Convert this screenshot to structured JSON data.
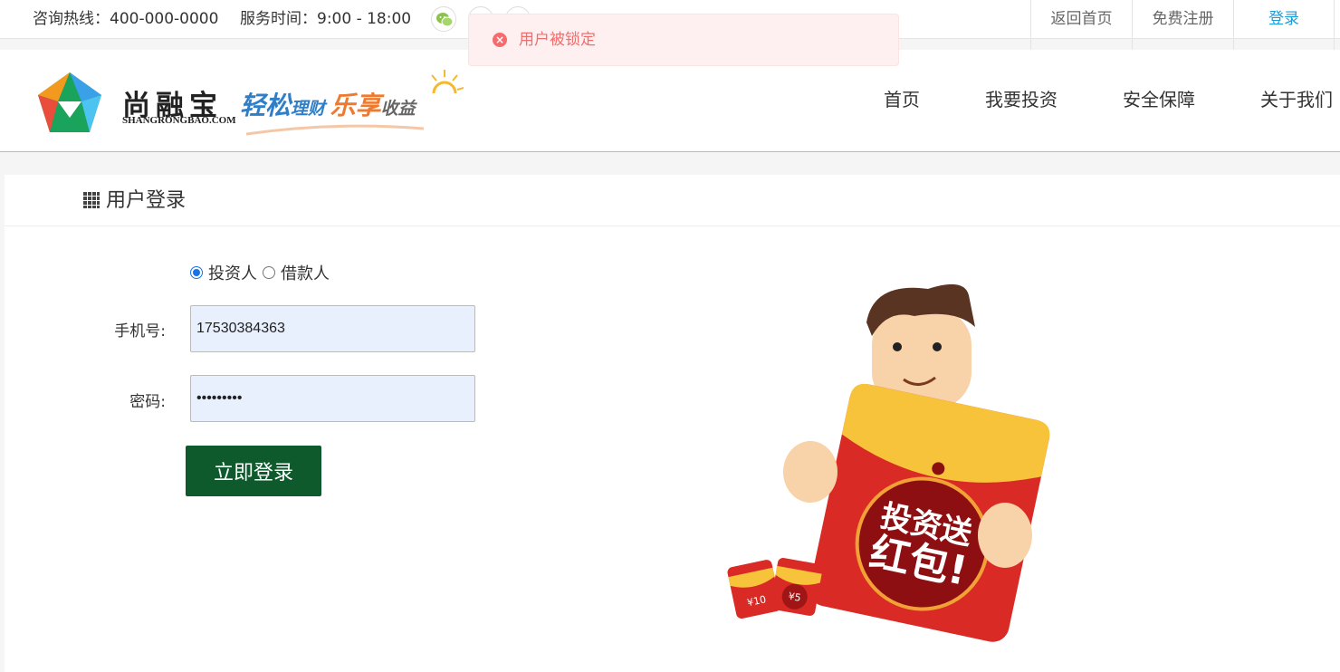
{
  "topbar": {
    "hotline": "咨询热线：400-000-0000",
    "service_hours": "服务时间：9:00 - 18:00",
    "links": [
      "返回首页",
      "免费注册",
      "登录"
    ],
    "social_icons": [
      "wechat-icon",
      "weibo-icon",
      "qq-icon"
    ]
  },
  "toast": {
    "message": "用户被锁定",
    "icon": "error-circle-icon",
    "color": "#f56c6c"
  },
  "header": {
    "brand_cn": "尚融宝",
    "brand_en": "SHANGRONGBAO.COM",
    "slogan": {
      "part1": "轻松",
      "part2": "理财",
      "part3": "乐享",
      "part4": "收益"
    },
    "nav": [
      "首页",
      "我要投资",
      "安全保障",
      "关于我们"
    ]
  },
  "login": {
    "title": "用户登录",
    "user_types": [
      "投资人",
      "借款人"
    ],
    "selected_type": "投资人",
    "mobile_label": "手机号:",
    "mobile_value": "17530384363",
    "password_label": "密码:",
    "password_value": "123456789",
    "submit_label": "立即登录",
    "submit_color": "#0f5a2c"
  },
  "illustration": {
    "envelope_text_line1": "投资送",
    "envelope_text_line2": "红包!",
    "small_packet_1": "¥10",
    "small_packet_2": "¥5"
  }
}
